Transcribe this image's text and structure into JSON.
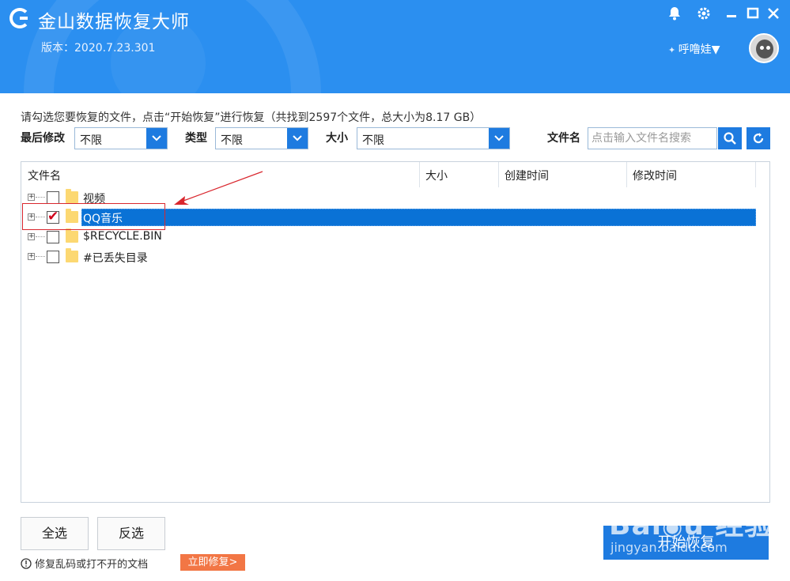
{
  "app": {
    "title": "金山数据恢复大师",
    "version": "版本：2020.7.23.301",
    "user_label": "呼噜娃▼"
  },
  "summary": "请勾选您要恢复的文件，点击“开始恢复”进行恢复（共找到2597个文件，总大小为8.17 GB）",
  "filters": {
    "modified_label": "最后修改",
    "modified_value": "不限",
    "type_label": "类型",
    "type_value": "不限",
    "size_label": "大小",
    "size_value": "不限",
    "filename_label": "文件名",
    "search_placeholder": "点击输入文件名搜索"
  },
  "table": {
    "columns": [
      "文件名",
      "大小",
      "创建时间",
      "修改时间"
    ],
    "rows": [
      {
        "name": "视频",
        "checked": false,
        "selected": false
      },
      {
        "name": "QQ音乐",
        "checked": true,
        "selected": true
      },
      {
        "name": "$RECYCLE.BIN",
        "checked": false,
        "selected": false
      },
      {
        "name": "#已丢失目录",
        "checked": false,
        "selected": false
      }
    ]
  },
  "buttons": {
    "select_all": "全选",
    "invert": "反选",
    "start": "开始恢复",
    "repair": "立即修复>"
  },
  "notice": "修复乱码或打不开的文档",
  "colors": {
    "header": "#2b8ff0",
    "accent": "#1e7be0",
    "selection": "#0a72d6",
    "repair": "#f27645",
    "annotation": "#d9272e"
  }
}
